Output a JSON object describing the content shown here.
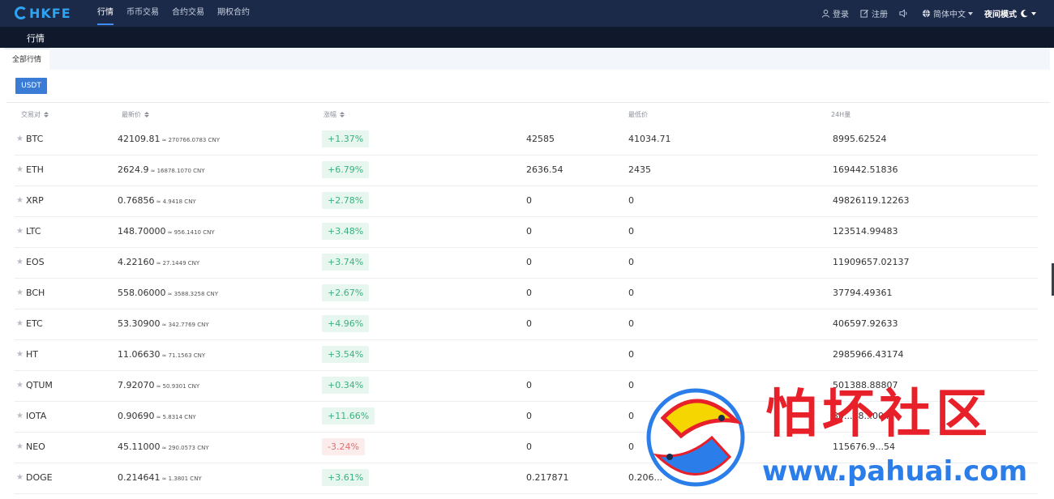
{
  "header": {
    "logo_text": "HKFE",
    "nav": [
      "行情",
      "币币交易",
      "合约交易",
      "期权合约"
    ],
    "right": {
      "login": "登录",
      "register": "注册",
      "language": "简体中文",
      "night_mode": "夜间模式"
    }
  },
  "subbar": {
    "title": "行情"
  },
  "tabs": {
    "active": "全部行情"
  },
  "filter": {
    "usdt": "USDT"
  },
  "table": {
    "headers": {
      "pair": "交易对",
      "price": "最新价",
      "change": "涨幅",
      "high": "",
      "low": "最低价",
      "volume": "24H量"
    },
    "rows": [
      {
        "pair": "BTC",
        "price": "42109.81",
        "cny": "≈ 270766.0783 CNY",
        "change": "+1.37%",
        "dir": "up",
        "high": "42585",
        "low": "41034.71",
        "volume": "8995.62524"
      },
      {
        "pair": "ETH",
        "price": "2624.9",
        "cny": "≈ 16878.1070 CNY",
        "change": "+6.79%",
        "dir": "up",
        "high": "2636.54",
        "low": "2435",
        "volume": "169442.51836"
      },
      {
        "pair": "XRP",
        "price": "0.76856",
        "cny": "≈ 4.9418 CNY",
        "change": "+2.78%",
        "dir": "up",
        "high": "0",
        "low": "0",
        "volume": "49826119.12263"
      },
      {
        "pair": "LTC",
        "price": "148.70000",
        "cny": "≈ 956.1410 CNY",
        "change": "+3.48%",
        "dir": "up",
        "high": "0",
        "low": "0",
        "volume": "123514.99483"
      },
      {
        "pair": "EOS",
        "price": "4.22160",
        "cny": "≈ 27.1449 CNY",
        "change": "+3.74%",
        "dir": "up",
        "high": "0",
        "low": "0",
        "volume": "11909657.02137"
      },
      {
        "pair": "BCH",
        "price": "558.06000",
        "cny": "≈ 3588.3258 CNY",
        "change": "+2.67%",
        "dir": "up",
        "high": "0",
        "low": "0",
        "volume": "37794.49361"
      },
      {
        "pair": "ETC",
        "price": "53.30900",
        "cny": "≈ 342.7769 CNY",
        "change": "+4.96%",
        "dir": "up",
        "high": "0",
        "low": "0",
        "volume": "406597.92633"
      },
      {
        "pair": "HT",
        "price": "11.06630",
        "cny": "≈ 71.1563 CNY",
        "change": "+3.54%",
        "dir": "up",
        "high": "",
        "low": "0",
        "volume": "2985966.43174"
      },
      {
        "pair": "QTUM",
        "price": "7.92070",
        "cny": "≈ 50.9301 CNY",
        "change": "+0.34%",
        "dir": "up",
        "high": "0",
        "low": "0",
        "volume": "501388.88807"
      },
      {
        "pair": "IOTA",
        "price": "0.90690",
        "cny": "≈ 5.8314 CNY",
        "change": "+11.66%",
        "dir": "up",
        "high": "0",
        "low": "0",
        "volume": "30...88...004"
      },
      {
        "pair": "NEO",
        "price": "45.11000",
        "cny": "≈ 290.0573 CNY",
        "change": "-3.24%",
        "dir": "dn",
        "high": "0",
        "low": "0",
        "volume": "115676.9...54"
      },
      {
        "pair": "DOGE",
        "price": "0.214641",
        "cny": "≈ 1.3801 CNY",
        "change": "+3.61%",
        "dir": "up",
        "high": "0.217871",
        "low": "0.206...",
        "volume": "..."
      }
    ]
  },
  "watermark": {
    "title": "怕坏社区",
    "url": "www.pahuai.com"
  },
  "colors": {
    "header_bg": "#1c2a4a",
    "accent": "#3a7bd5",
    "up": "#3bb27e",
    "down": "#e07070",
    "watermark_red": "#e8202a",
    "watermark_blue": "#2b7de9"
  }
}
